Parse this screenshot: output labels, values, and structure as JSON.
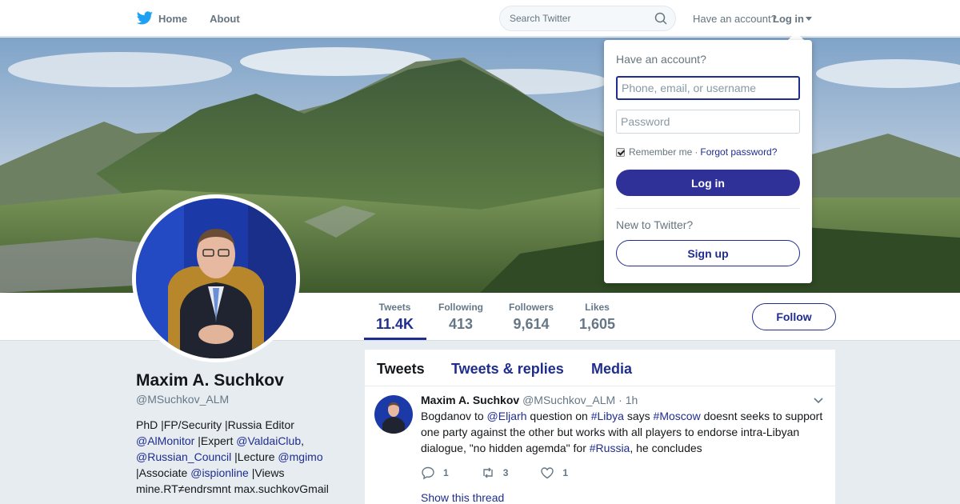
{
  "nav": {
    "home_label": "Home",
    "about_label": "About",
    "search_placeholder": "Search Twitter",
    "have_account": "Have an account?",
    "login_label": "Log in"
  },
  "stats": [
    {
      "label": "Tweets",
      "value": "11.4K"
    },
    {
      "label": "Following",
      "value": "413"
    },
    {
      "label": "Followers",
      "value": "9,614"
    },
    {
      "label": "Likes",
      "value": "1,605"
    }
  ],
  "follow_label": "Follow",
  "profile": {
    "name": "Maxim A. Suchkov",
    "handle": "@MSuchkov_ALM",
    "bio": {
      "t1": "PhD |FP/Security |Russia Editor ",
      "m1": "@AlMonitor",
      "t2": " |Expert ",
      "m2": "@ValdaiClub",
      "t3": ", ",
      "m3": "@Russian_Council",
      "t4": " |Lecture ",
      "m4": "@mgimo",
      "t5": " |Associate ",
      "m5": "@ispionline",
      "t6": " |Views mine.RT≠endrsmnt max.suchkovGmail"
    }
  },
  "timeline": {
    "tabs": [
      "Tweets",
      "Tweets & replies",
      "Media"
    ],
    "tweet": {
      "fullname": "Maxim A. Suchkov",
      "handle": "@MSuchkov_ALM",
      "dot": "·",
      "time": "1h",
      "text": {
        "t1": "Bogdanov to ",
        "m1": "@Eljarh",
        "t2": " question on ",
        "h1": "#Libya",
        "t3": " says ",
        "h2": "#Moscow",
        "t4": " doesnt seeks to support one party against the other but works with all players to endorse intra-Libyan dialogue, \"no hidden agemda\" for ",
        "h3": "#Russia",
        "t5": ", he concludes"
      },
      "replies": "1",
      "retweets": "3",
      "likes": "1",
      "show_thread": "Show this thread"
    }
  },
  "login_dropdown": {
    "title": "Have an account?",
    "username_placeholder": "Phone, email, or username",
    "password_placeholder": "Password",
    "remember": "Remember me",
    "separator": "·",
    "forgot": "Forgot password?",
    "login_button": "Log in",
    "new_to_twitter": "New to Twitter?",
    "signup_button": "Sign up"
  },
  "colors": {
    "accent": "#1f2d8f",
    "login_button_bg": "#2f3199",
    "background": "#e6ecf0"
  }
}
